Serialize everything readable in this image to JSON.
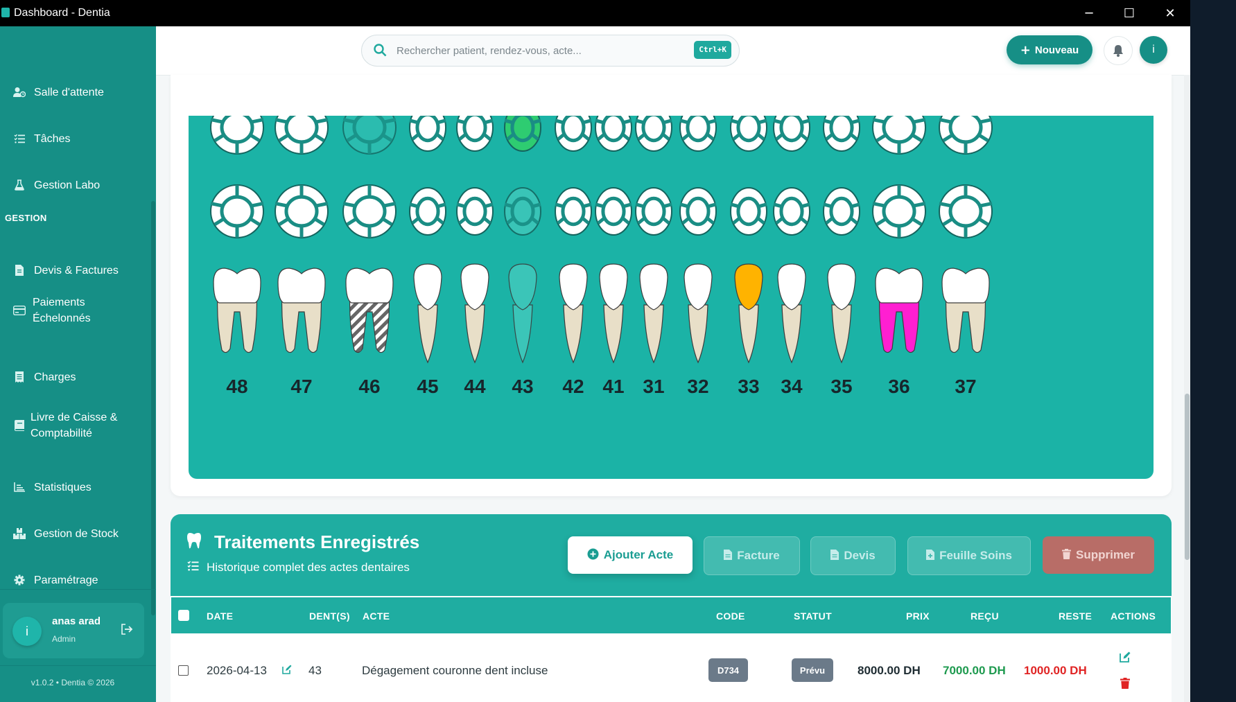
{
  "window": {
    "title": "Dashboard - Dentia",
    "controls": [
      "─",
      "☐",
      "✕"
    ]
  },
  "sidebar": {
    "items_top": [
      {
        "label": "Salle d'attente",
        "icon": "user-clock-icon"
      },
      {
        "label": "Tâches",
        "icon": "list-check-icon"
      },
      {
        "label": "Gestion Labo",
        "icon": "flask-icon"
      }
    ],
    "section": "GESTION",
    "items": [
      {
        "label": "Devis & Factures",
        "icon": "file-invoice-icon"
      },
      {
        "label": "Paiements",
        "label2": "Échelonnés",
        "icon": "credit-card-icon"
      },
      {
        "label": "Charges",
        "icon": "receipt-icon"
      },
      {
        "label": "Livre de Caisse &",
        "label2": "Comptabilité",
        "icon": "book-icon"
      },
      {
        "label": "Statistiques",
        "icon": "chart-line-icon"
      },
      {
        "label": "Gestion de Stock",
        "icon": "boxes-icon"
      },
      {
        "label": "Paramétrage",
        "icon": "gear-icon"
      }
    ],
    "user": {
      "initial": "i",
      "name": "anas arad",
      "role": "Admin"
    },
    "version": "v1.0.2 • Dentia © 2026"
  },
  "topbar": {
    "search_placeholder": "Rechercher patient, rendez-vous, acte...",
    "shortcut": "Ctrl+K",
    "new_button": "Nouveau",
    "avatar_initial": "i"
  },
  "odontogram": {
    "teeth": [
      "48",
      "47",
      "46",
      "45",
      "44",
      "43",
      "42",
      "41",
      "31",
      "32",
      "33",
      "34",
      "35",
      "36",
      "37"
    ],
    "status_colors": {
      "selected": "#2ecc71",
      "crown": "#ffb300",
      "root_canal": "#ff1fd1",
      "missing": "#3fc7bb"
    },
    "marked": {
      "43": "missing-root / selected occlusal",
      "46": "hatched roots",
      "33": "crown",
      "36": "root canal"
    }
  },
  "treatments": {
    "title": "Traitements Enregistrés",
    "subtitle": "Historique complet des actes dentaires",
    "buttons": {
      "add": "Ajouter Acte",
      "invoice": "Facture",
      "quote": "Devis",
      "sheet": "Feuille Soins",
      "delete": "Supprimer"
    },
    "columns": {
      "date": "DATE",
      "teeth": "DENT(S)",
      "act": "ACTE",
      "code": "CODE",
      "status": "STATUT",
      "price": "PRIX",
      "received": "REÇU",
      "remaining": "RESTE",
      "actions": "ACTIONS"
    },
    "rows": [
      {
        "date": "2026-04-13",
        "teeth": "43",
        "act": "Dégagement couronne dent incluse",
        "code": "D734",
        "status": "Prévu",
        "price": "8000.00 DH",
        "received": "7000.00 DH",
        "remaining": "1000.00 DH"
      }
    ]
  }
}
